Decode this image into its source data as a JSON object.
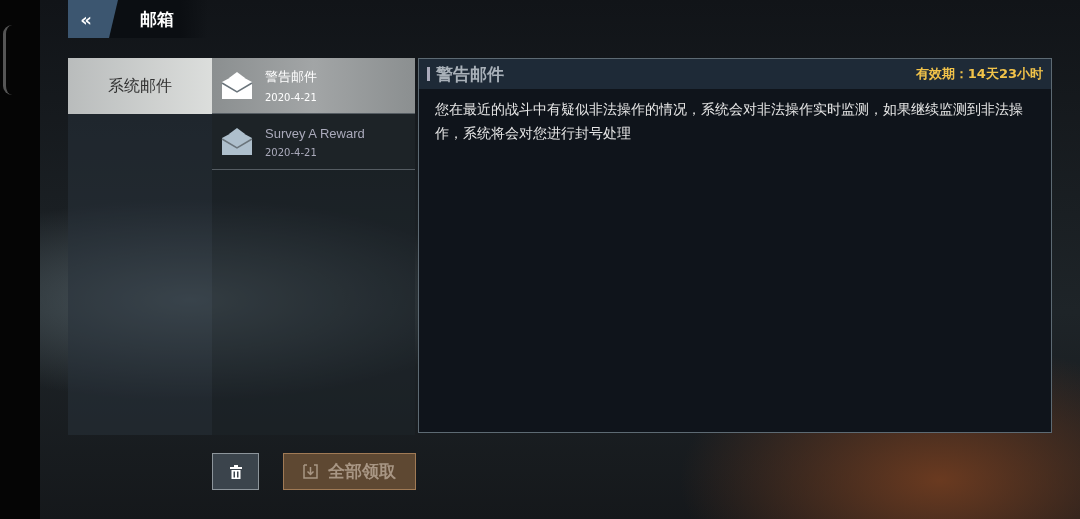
{
  "header": {
    "back": "«",
    "title": "邮箱"
  },
  "categories": [
    {
      "label": "系统邮件",
      "selected": true
    }
  ],
  "mails": [
    {
      "title": "警告邮件",
      "date": "2020-4-21",
      "selected": true
    },
    {
      "title": "Survey A Reward",
      "date": "2020-4-21",
      "selected": false
    }
  ],
  "detail": {
    "title": "警告邮件",
    "validity": "有效期：14天23小时",
    "body": "您在最近的战斗中有疑似非法操作的情况，系统会对非法操作实时监测，如果继续监测到非法操作，系统将会对您进行封号处理"
  },
  "actions": {
    "claim_all": {
      "label": "全部领取",
      "disabled": true
    }
  }
}
